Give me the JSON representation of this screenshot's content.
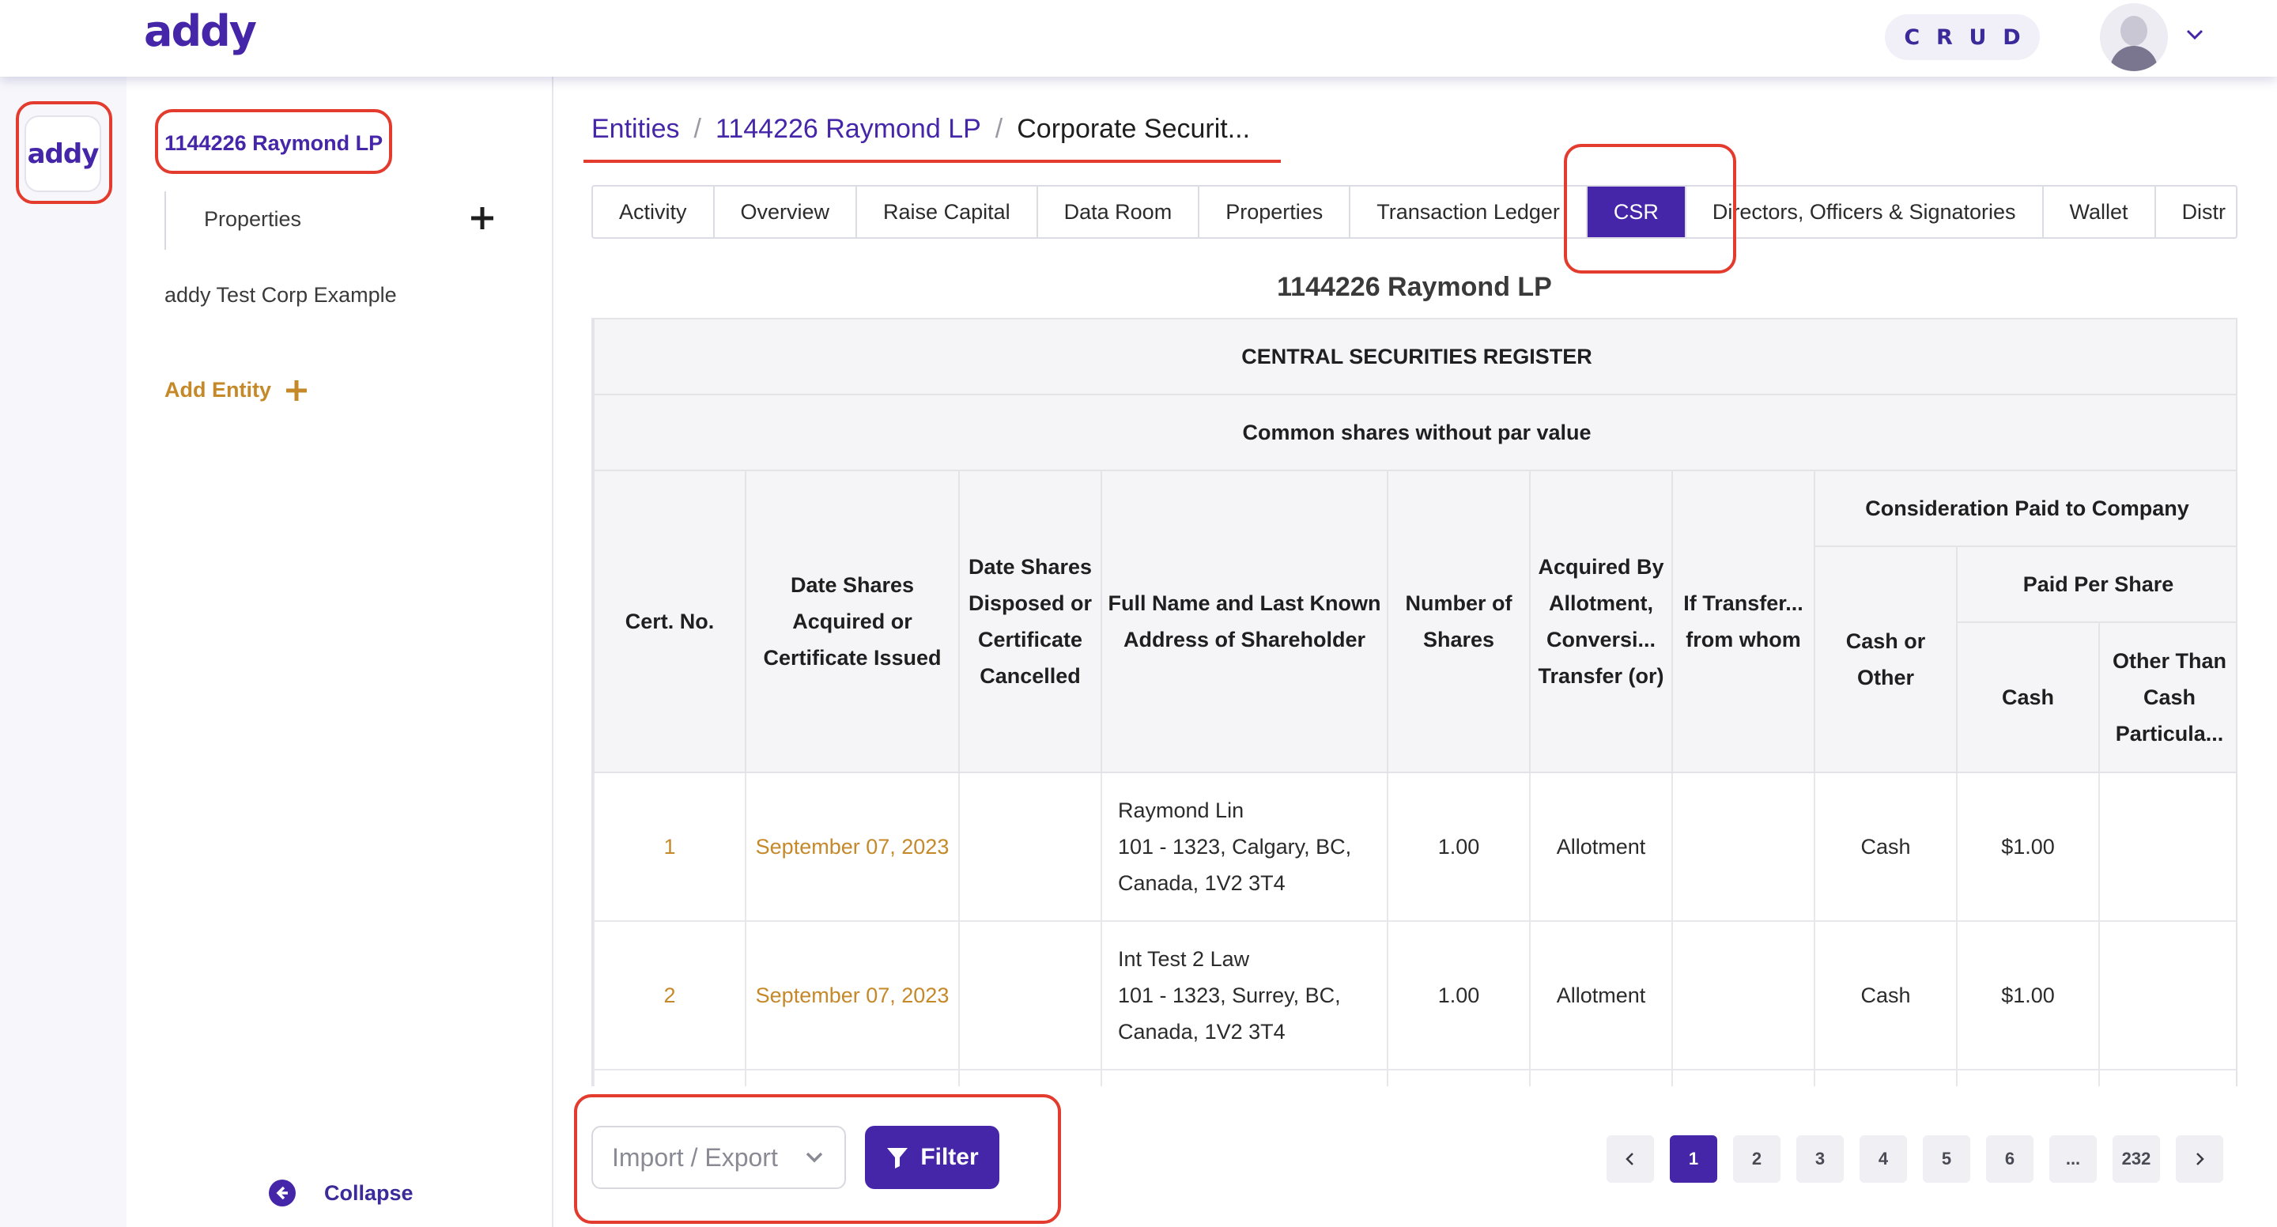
{
  "header": {
    "logo": "addy",
    "crud": [
      "C",
      "R",
      "U",
      "D"
    ],
    "avatar_icon": "user-avatar-icon",
    "caret_icon": "chevron-down-icon"
  },
  "rail": {
    "logo": "addy"
  },
  "sidebar": {
    "entity_title": "1144226 Raymond LP",
    "properties_label": "Properties",
    "corp_label": "addy Test Corp Example",
    "add_entity_label": "Add Entity",
    "collapse_label": "Collapse"
  },
  "breadcrumb": {
    "items": [
      "Entities",
      "1144226 Raymond LP"
    ],
    "current": "Corporate Securit...",
    "separator": "/"
  },
  "tabs": [
    {
      "label": "Activity"
    },
    {
      "label": "Overview"
    },
    {
      "label": "Raise Capital"
    },
    {
      "label": "Data Room"
    },
    {
      "label": "Properties"
    },
    {
      "label": "Transaction Ledger"
    },
    {
      "label": "CSR",
      "active": true
    },
    {
      "label": "Directors, Officers & Signatories"
    },
    {
      "label": "Wallet"
    },
    {
      "label": "Distr"
    }
  ],
  "register": {
    "entity_name": "1144226 Raymond LP",
    "heading": "CENTRAL SECURITIES REGISTER",
    "share_class": "Common shares without par value",
    "consideration_header": "Consideration Paid to Company",
    "paid_per_share_header": "Paid Per Share",
    "columns": {
      "cert_no": "Cert. No.",
      "date_acquired": "Date Shares Acquired or Certificate Issued",
      "date_disposed": "Date Shares Disposed or Certificate Cancelled",
      "full_name": "Full Name and Last Known Address of Shareholder",
      "number_shares": "Number of Shares",
      "acquired_by": "Acquired By Allotment, Conversi... Transfer (or)",
      "if_transfer": "If Transfer... from whom",
      "cash_or_other": "Cash or Other",
      "cash": "Cash",
      "other_than_cash": "Other Than Cash Particula..."
    },
    "rows": [
      {
        "cert": "1",
        "date": "September 07, 2023",
        "disposed": "",
        "name": "Raymond Lin",
        "address1": "101 - 1323, Calgary, BC,",
        "address2": "Canada, 1V2 3T4",
        "shares": "1.00",
        "acquired_by": "Allotment",
        "transfer_from": "",
        "cash_or_other": "Cash",
        "cash": "$1.00",
        "other": ""
      },
      {
        "cert": "2",
        "date": "September 07, 2023",
        "disposed": "",
        "name": "Int Test 2 Law",
        "address1": "101 - 1323, Surrey, BC,",
        "address2": "Canada, 1V2 3T4",
        "shares": "1.00",
        "acquired_by": "Allotment",
        "transfer_from": "",
        "cash_or_other": "Cash",
        "cash": "$1.00",
        "other": ""
      }
    ]
  },
  "toolbar": {
    "import_export_placeholder": "Import / Export",
    "filter_label": "Filter"
  },
  "pagination": {
    "pages": [
      "1",
      "2",
      "3",
      "4",
      "5",
      "6",
      "...",
      "232"
    ],
    "active": "1"
  },
  "colors": {
    "brand": "#4526a8",
    "accent_orange": "#c5892a",
    "annotation_red": "#e33b2e"
  }
}
